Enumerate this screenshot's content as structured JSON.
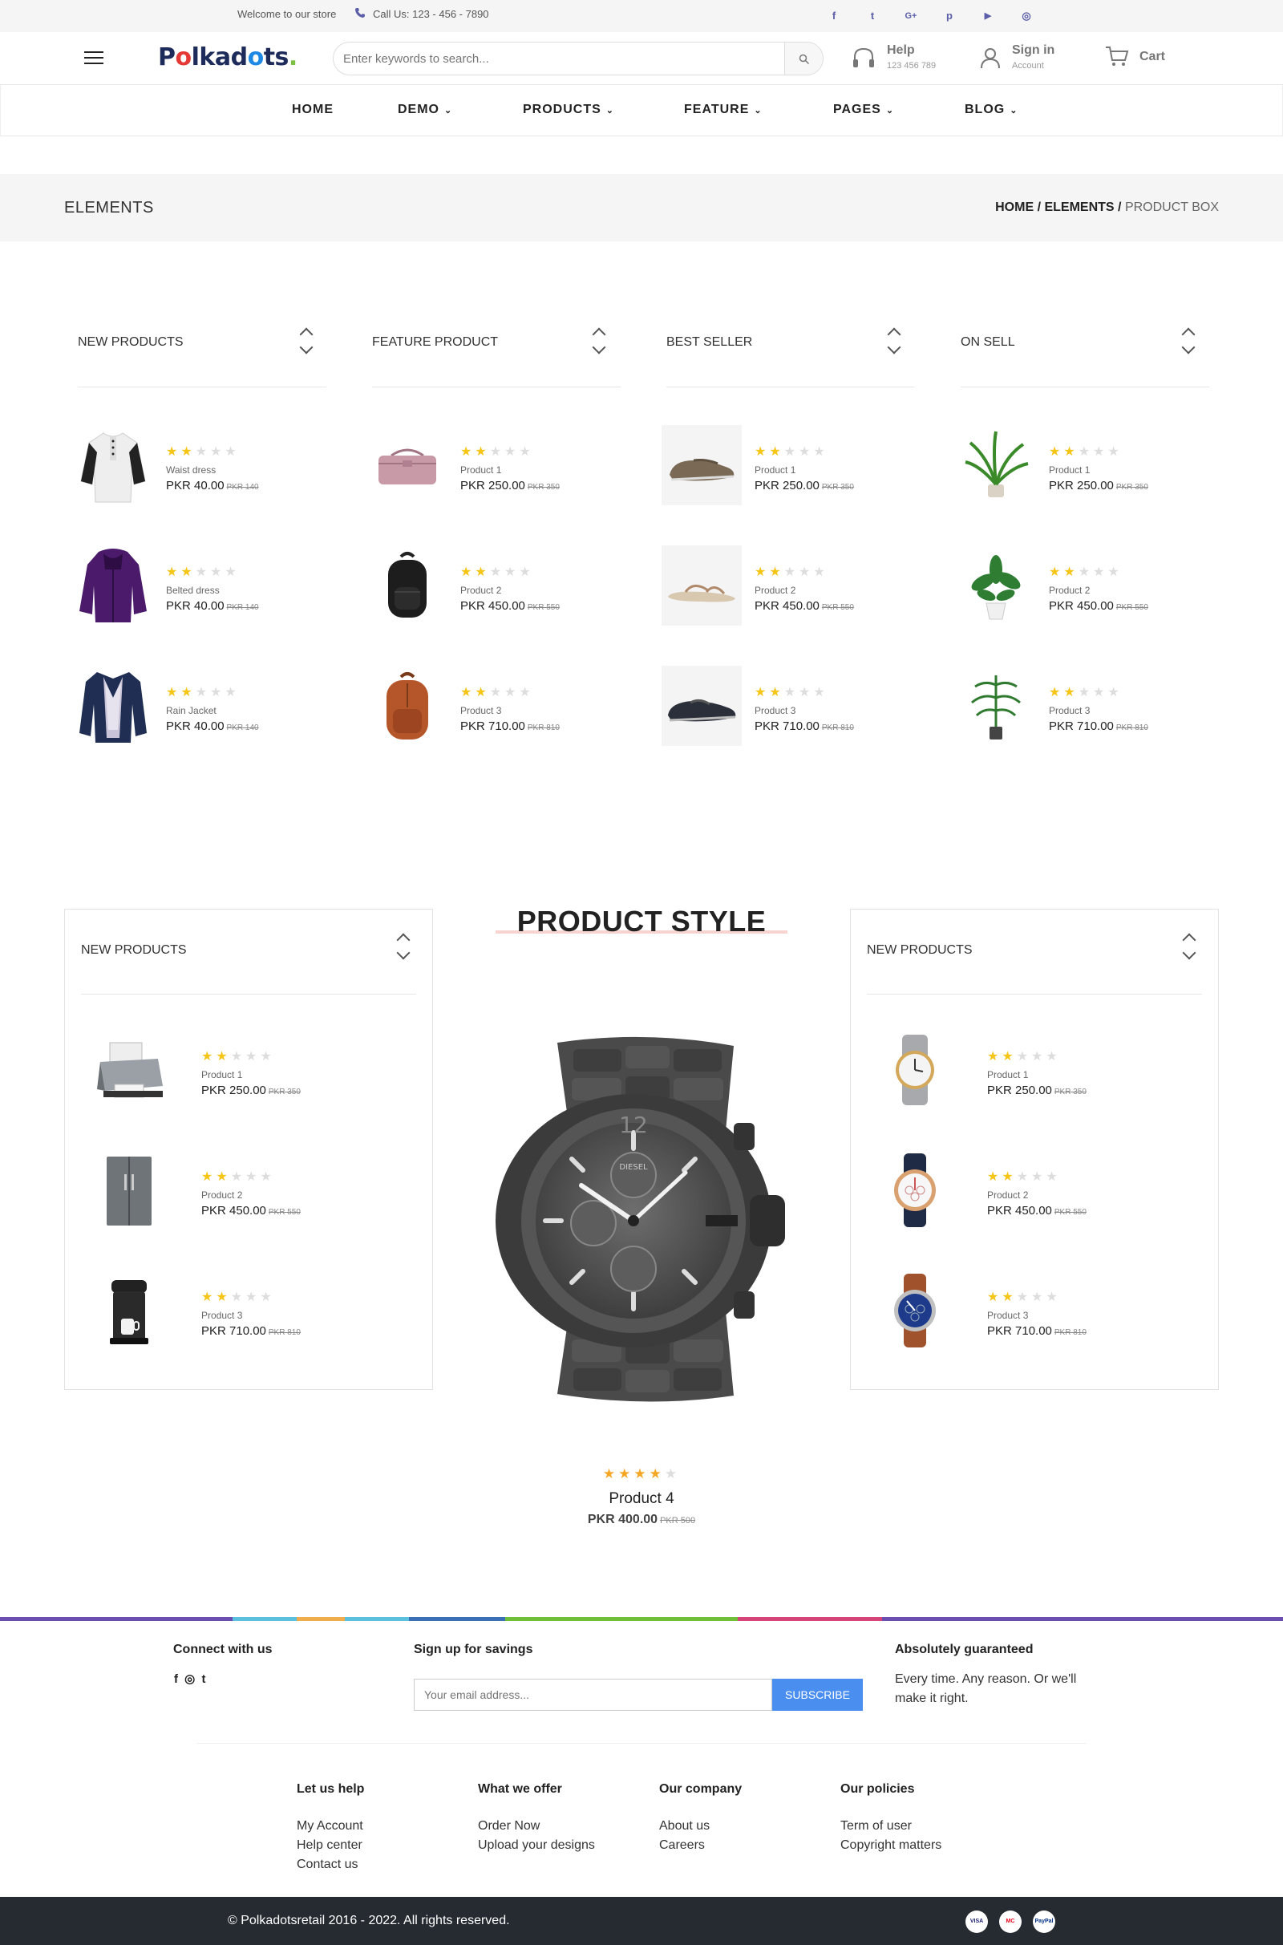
{
  "topbar": {
    "welcome": "Welcome to our store",
    "call": "Call Us: 123 - 456 - 7890",
    "socials": [
      "facebook-icon",
      "twitter-icon",
      "google-plus-icon",
      "pinterest-icon",
      "youtube-icon",
      "instagram-icon"
    ],
    "social_glyphs": [
      "f",
      "t",
      "G+",
      "p",
      "▶",
      "◎"
    ]
  },
  "header": {
    "logo": "Polkadots.",
    "search_placeholder": "Enter keywords to search...",
    "help": {
      "title": "Help",
      "sub": "123 456 789"
    },
    "account": {
      "title": "Sign in",
      "sub": "Account"
    },
    "cart": {
      "title": "Cart"
    }
  },
  "nav": [
    {
      "label": "HOME",
      "dropdown": false
    },
    {
      "label": "DEMO",
      "dropdown": true
    },
    {
      "label": "PRODUCTS",
      "dropdown": true
    },
    {
      "label": "FEATURE",
      "dropdown": true
    },
    {
      "label": "PAGES",
      "dropdown": true
    },
    {
      "label": "BLOG",
      "dropdown": true
    }
  ],
  "band": {
    "title": "ELEMENTS",
    "crumb_home": "HOME /",
    "crumb_elements": "ELEMENTS /",
    "crumb_current": "PRODUCT BOX"
  },
  "columns": [
    {
      "title": "NEW PRODUCTS",
      "items": [
        {
          "name": "Waist dress",
          "price": "PKR 40.00",
          "old": "PKR 140",
          "rating": 2,
          "icon": "shirt-icon"
        },
        {
          "name": "Belted dress",
          "price": "PKR 40.00",
          "old": "PKR 140",
          "rating": 2,
          "icon": "purple-jacket-icon"
        },
        {
          "name": "Rain Jacket",
          "price": "PKR 40.00",
          "old": "PKR 140",
          "rating": 2,
          "icon": "navy-jacket-icon"
        }
      ]
    },
    {
      "title": "FEATURE PRODUCT",
      "items": [
        {
          "name": "Product 1",
          "price": "PKR 250.00",
          "old": "PKR 350",
          "rating": 2,
          "icon": "pink-bag-icon"
        },
        {
          "name": "Product 2",
          "price": "PKR 450.00",
          "old": "PKR 550",
          "rating": 2,
          "icon": "black-backpack-icon"
        },
        {
          "name": "Product 3",
          "price": "PKR 710.00",
          "old": "PKR 810",
          "rating": 2,
          "icon": "brown-backpack-icon"
        }
      ]
    },
    {
      "title": "BEST SELLER",
      "items": [
        {
          "name": "Product 1",
          "price": "PKR 250.00",
          "old": "PKR 350",
          "rating": 2,
          "icon": "loafer-icon"
        },
        {
          "name": "Product 2",
          "price": "PKR 450.00",
          "old": "PKR 550",
          "rating": 2,
          "icon": "sandal-icon"
        },
        {
          "name": "Product 3",
          "price": "PKR 710.00",
          "old": "PKR 810",
          "rating": 2,
          "icon": "dark-shoe-icon"
        }
      ]
    },
    {
      "title": "ON SELL",
      "items": [
        {
          "name": "Product 1",
          "price": "PKR 250.00",
          "old": "PKR 350",
          "rating": 2,
          "icon": "palm-plant-icon"
        },
        {
          "name": "Product 2",
          "price": "PKR 450.00",
          "old": "PKR 550",
          "rating": 2,
          "icon": "potted-plant-icon"
        },
        {
          "name": "Product 3",
          "price": "PKR 710.00",
          "old": "PKR 810",
          "rating": 2,
          "icon": "tall-plant-icon"
        }
      ]
    }
  ],
  "product_style": {
    "title": "PRODUCT STYLE",
    "left_box": {
      "title": "NEW PRODUCTS",
      "items": [
        {
          "name": "Product 1",
          "price": "PKR 250.00",
          "old": "PKR 350",
          "rating": 2,
          "icon": "printer-icon"
        },
        {
          "name": "Product 2",
          "price": "PKR 450.00",
          "old": "PKR 550",
          "rating": 2,
          "icon": "fridge-icon"
        },
        {
          "name": "Product 3",
          "price": "PKR 710.00",
          "old": "PKR 810",
          "rating": 2,
          "icon": "coffee-maker-icon"
        }
      ]
    },
    "right_box": {
      "title": "NEW PRODUCTS",
      "items": [
        {
          "name": "Product 1",
          "price": "PKR 250.00",
          "old": "PKR 350",
          "rating": 2,
          "icon": "silver-watch-icon"
        },
        {
          "name": "Product 2",
          "price": "PKR 450.00",
          "old": "PKR 550",
          "rating": 2,
          "icon": "white-watch-icon"
        },
        {
          "name": "Product 3",
          "price": "PKR 710.00",
          "old": "PKR 810",
          "rating": 2,
          "icon": "blue-watch-icon"
        }
      ]
    },
    "featured": {
      "name": "Product 4",
      "price": "PKR 400.00",
      "old": "PKR 500",
      "rating": 4,
      "icon": "gunmetal-watch-icon",
      "brand": "DIESEL"
    }
  },
  "footer": {
    "colors": [
      "#6a4fb0",
      "#5bc0de",
      "#f0ad4e",
      "#5bc0de",
      "#3b6fb6",
      "#6fbf3b",
      "#d6457a",
      "#6a4fb0"
    ],
    "connect": "Connect with us",
    "connect_glyphs": [
      "f",
      "◎",
      "t"
    ],
    "signup": "Sign up for savings",
    "email_placeholder": "Your email address...",
    "subscribe": "SUBSCRIBE",
    "guaranteed_title": "Absolutely guaranteed",
    "guaranteed_text": "Every time. Any reason. Or we'll make it right.",
    "link_cols": [
      {
        "title": "Let us help",
        "links": [
          "My Account",
          "Help center",
          "Contact us"
        ]
      },
      {
        "title": "What we offer",
        "links": [
          "Order Now",
          "Upload your designs"
        ]
      },
      {
        "title": "Our company",
        "links": [
          "About us",
          "Careers"
        ]
      },
      {
        "title": "Our policies",
        "links": [
          "Term of user",
          "Copyright matters"
        ]
      }
    ],
    "copyright": "© Polkadotsretail 2016 - 2022. All rights reserved.",
    "payments": [
      "VISA",
      "MC",
      "PayPal"
    ]
  }
}
